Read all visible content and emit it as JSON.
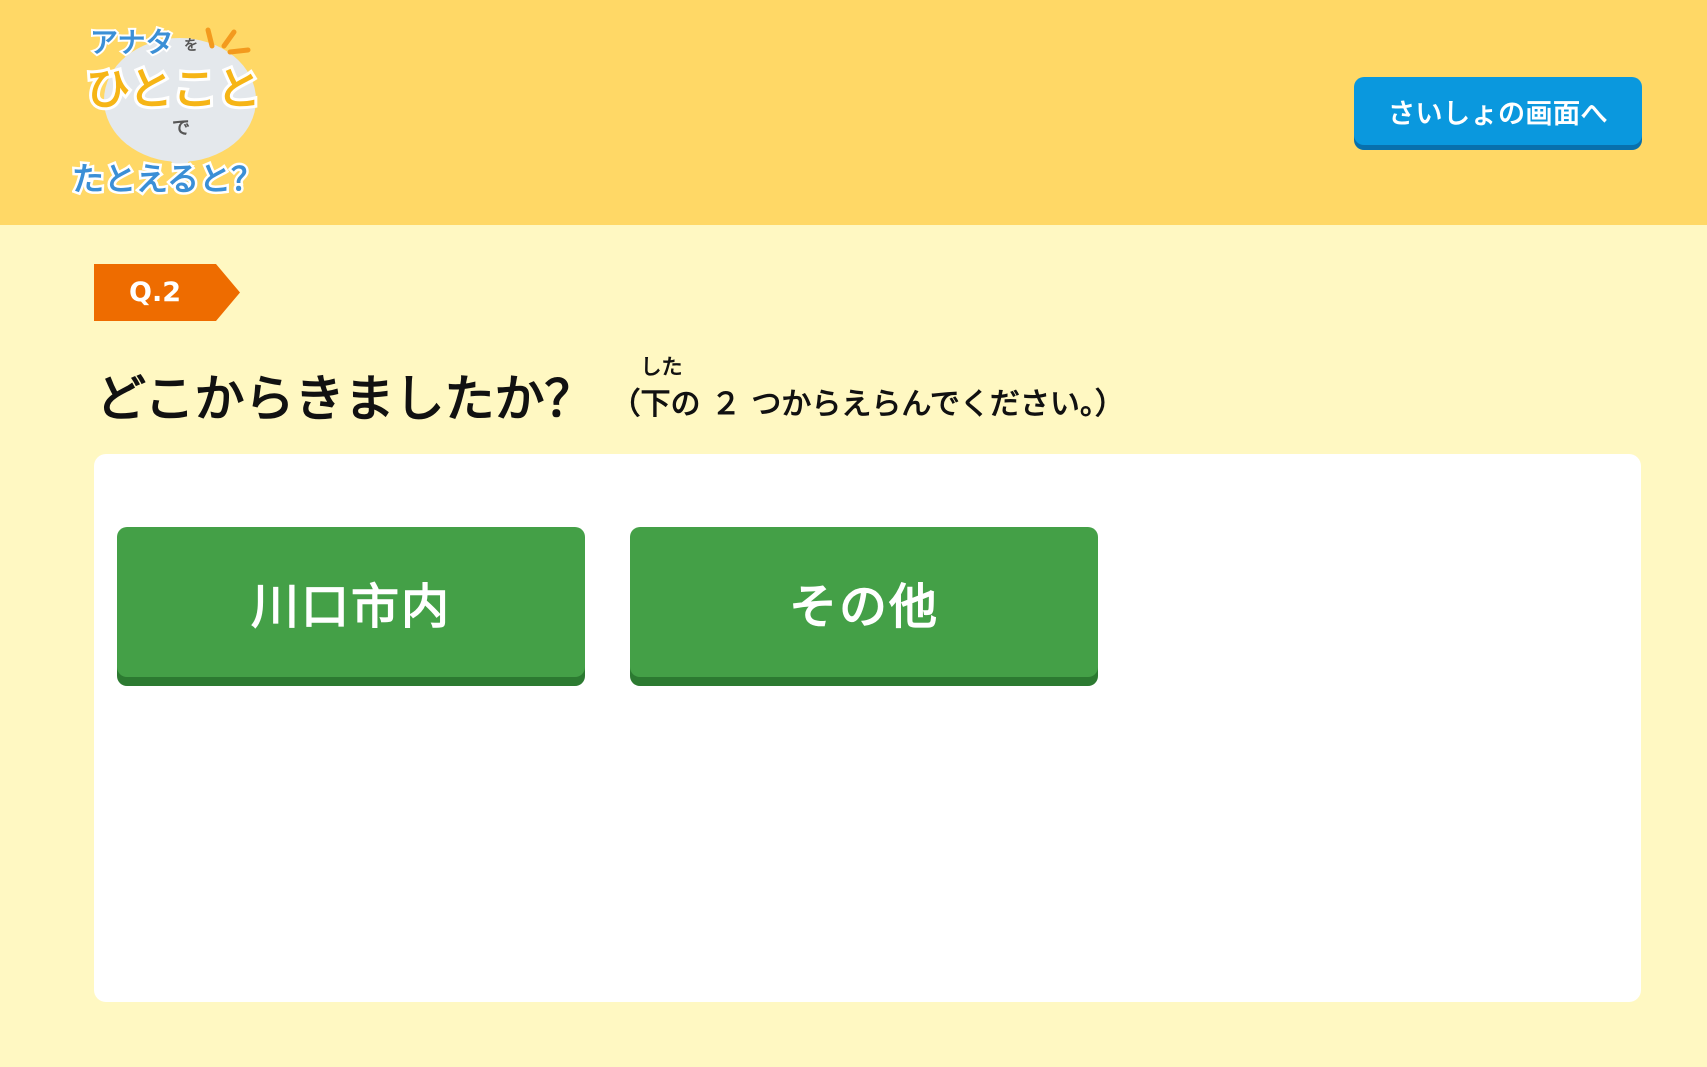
{
  "logo": {
    "line1": "アナタ",
    "particle_wo": "を",
    "line2": "ひとこと",
    "particle_de": "で",
    "line3": "たとえると？"
  },
  "header": {
    "back_button_label": "さいしょの画面へ"
  },
  "question": {
    "badge": "Q.2",
    "text": "どこからきましたか？",
    "note_open": "（",
    "note_kanji": "下",
    "note_kanji_reading": "した",
    "note_rest": "の ２ つからえらんでください。）"
  },
  "choices": [
    {
      "label": "川口市内"
    },
    {
      "label": "その他"
    }
  ],
  "colors": {
    "header_bg": "#ffd866",
    "page_bg": "#fff8c2",
    "badge": "#ee6c00",
    "back_button": "#0a98de",
    "choice_button": "#44a047"
  }
}
